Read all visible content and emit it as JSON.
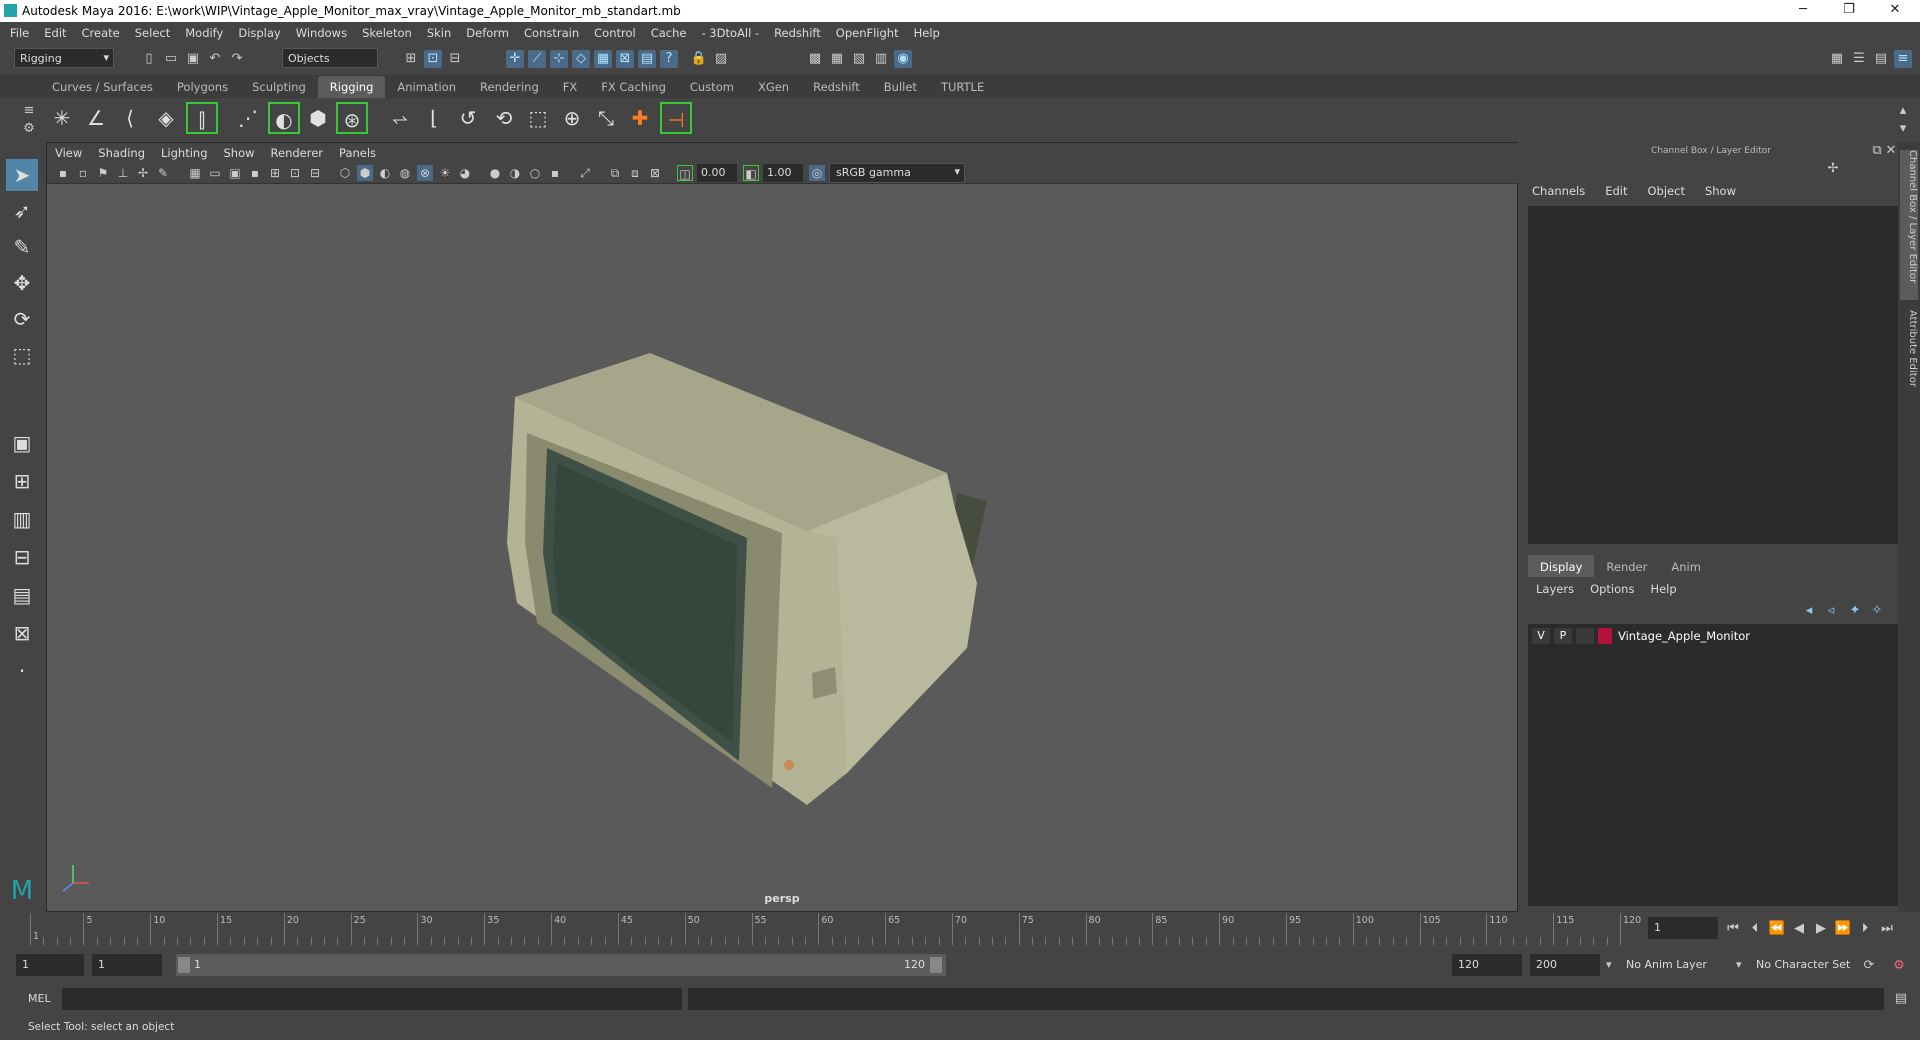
{
  "window": {
    "title": "Autodesk Maya 2016: E:\\work\\WIP\\Vintage_Apple_Monitor_max_vray\\Vintage_Apple_Monitor_mb_standart.mb",
    "minimize": "─",
    "restore": "❐",
    "close": "✕"
  },
  "menubar": [
    "File",
    "Edit",
    "Create",
    "Select",
    "Modify",
    "Display",
    "Windows",
    "Skeleton",
    "Skin",
    "Deform",
    "Constrain",
    "Control",
    "Cache",
    "- 3DtoAll -",
    "Redshift",
    "OpenFlight",
    "Help"
  ],
  "toolbar": {
    "mode": "Rigging",
    "selection_mask": "Objects"
  },
  "shelf_tabs": [
    "Curves / Surfaces",
    "Polygons",
    "Sculpting",
    "Rigging",
    "Animation",
    "Rendering",
    "FX",
    "FX Caching",
    "Custom",
    "XGen",
    "Redshift",
    "Bullet",
    "TURTLE"
  ],
  "active_shelf": "Rigging",
  "viewport": {
    "menu": [
      "View",
      "Shading",
      "Lighting",
      "Show",
      "Renderer",
      "Panels"
    ],
    "exposure": "0.00",
    "gamma": "1.00",
    "color_space": "sRGB gamma",
    "camera": "persp"
  },
  "channel_box": {
    "title": "Channel Box / Layer Editor",
    "menu": [
      "Channels",
      "Edit",
      "Object",
      "Show"
    ]
  },
  "layer_editor": {
    "tabs": [
      "Display",
      "Render",
      "Anim"
    ],
    "active_tab": "Display",
    "menu": [
      "Layers",
      "Options",
      "Help"
    ],
    "layers": [
      {
        "v": "V",
        "p": "P",
        "name": "Vintage_Apple_Monitor",
        "color": "#b5123a"
      }
    ]
  },
  "side_tabs": [
    "Channel Box / Layer Editor",
    "Attribute Editor"
  ],
  "timeline": {
    "ticks": [
      "1",
      "5",
      "10",
      "15",
      "20",
      "25",
      "30",
      "35",
      "40",
      "45",
      "50",
      "55",
      "60",
      "65",
      "70",
      "75",
      "80",
      "85",
      "90",
      "95",
      "100",
      "105",
      "110",
      "115",
      "120"
    ],
    "current_frame": "1"
  },
  "range": {
    "start": "1",
    "playback_start": "1",
    "slider_start": "1",
    "slider_end": "120",
    "playback_end": "120",
    "end": "200",
    "anim_layer": "No Anim Layer",
    "character_set": "No Character Set"
  },
  "mel": {
    "label": "MEL"
  },
  "status": {
    "text": "Select Tool: select an object"
  }
}
